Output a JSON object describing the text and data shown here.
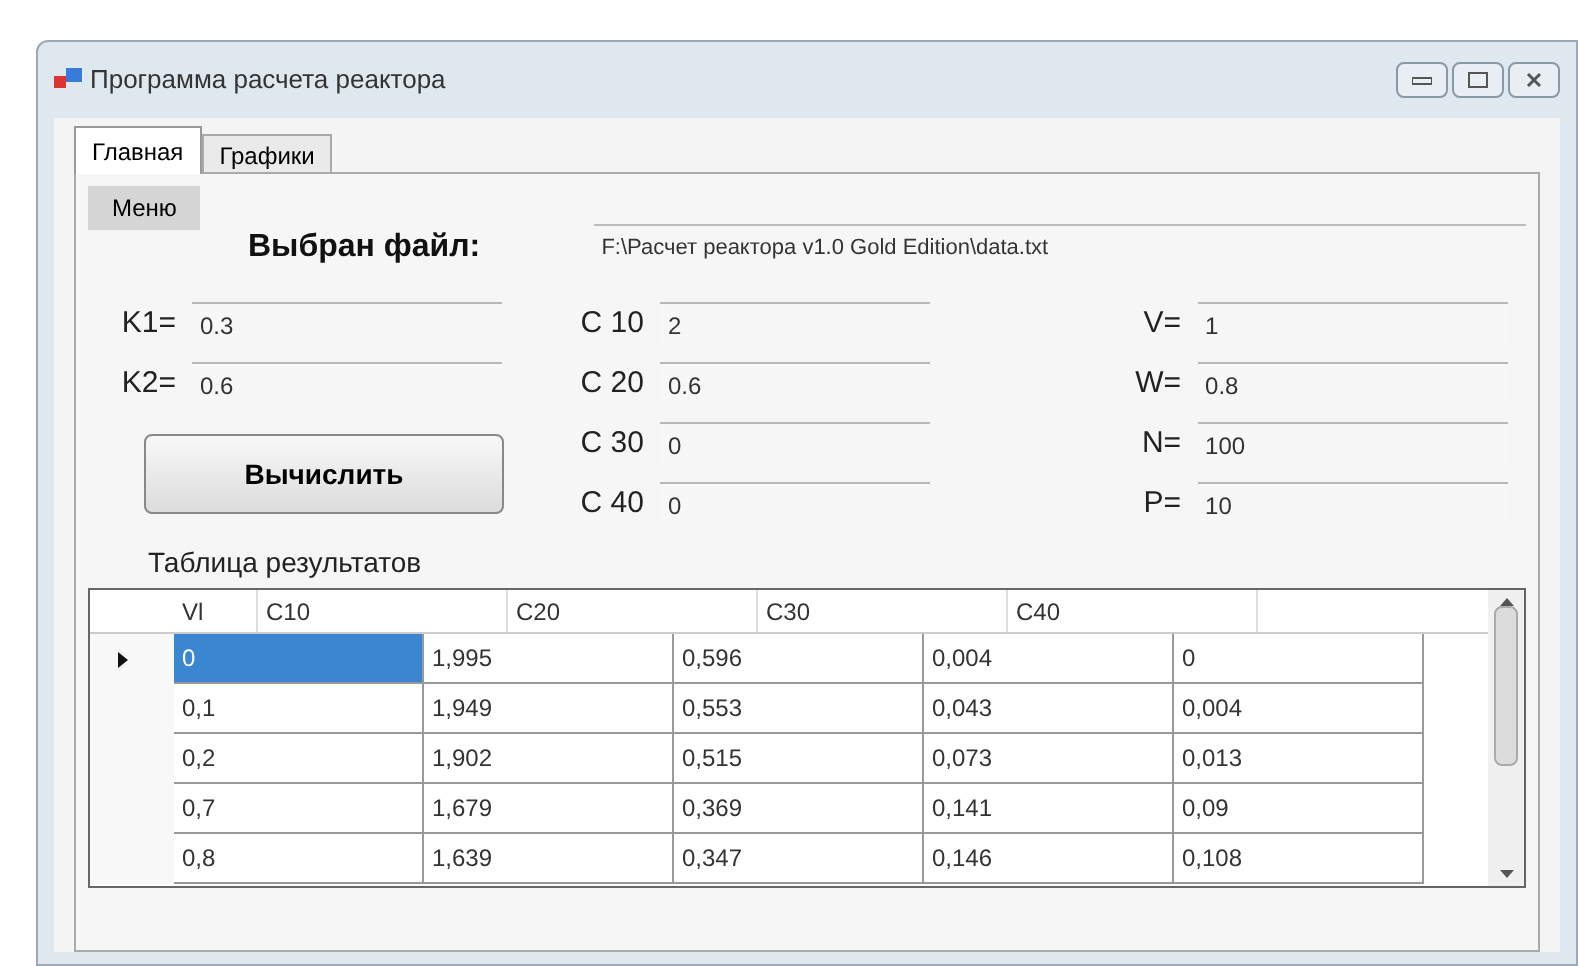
{
  "window": {
    "title": "Программа расчета реактора"
  },
  "tabs": [
    {
      "label": "Главная",
      "selected": true
    },
    {
      "label": "Графики",
      "selected": false
    }
  ],
  "menu_button": "Меню",
  "file": {
    "label": "Выбран файл:",
    "value": "F:\\Расчет реактора v1.0 Gold Edition\\data.txt"
  },
  "field_columns": [
    [
      {
        "label": "K1=",
        "value": "0.3"
      },
      {
        "label": "K2=",
        "value": "0.6"
      }
    ],
    [
      {
        "label": "C 10",
        "value": "2"
      },
      {
        "label": "C 20",
        "value": "0.6"
      },
      {
        "label": "C 30",
        "value": "0"
      },
      {
        "label": "C 40",
        "value": "0"
      }
    ],
    [
      {
        "label": "V=",
        "value": "1"
      },
      {
        "label": "W=",
        "value": "0.8"
      },
      {
        "label": "N=",
        "value": "100"
      },
      {
        "label": "P=",
        "value": "10"
      }
    ]
  ],
  "compute_button": "Вычислить",
  "table": {
    "title": "Таблица результатов",
    "columns": [
      "Vl",
      "C10",
      "C20",
      "C30",
      "C40"
    ],
    "rows": [
      {
        "selected": true,
        "cells": [
          "0",
          "1,995",
          "0,596",
          "0,004",
          "0"
        ]
      },
      {
        "selected": false,
        "cells": [
          "0,1",
          "1,949",
          "0,553",
          "0,043",
          "0,004"
        ]
      },
      {
        "selected": false,
        "cells": [
          "0,2",
          "1,902",
          "0,515",
          "0,073",
          "0,013"
        ]
      },
      {
        "selected": false,
        "cells": [
          "0,7",
          "1,679",
          "0,369",
          "0,141",
          "0,09"
        ]
      },
      {
        "selected": false,
        "cells": [
          "0,8",
          "1,639",
          "0,347",
          "0,146",
          "0,108"
        ]
      }
    ]
  }
}
